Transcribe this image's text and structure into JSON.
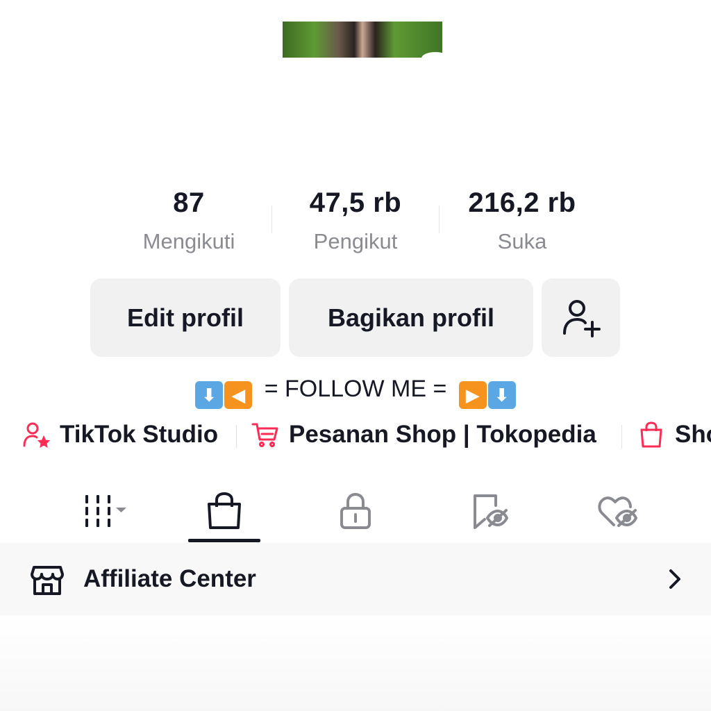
{
  "stats": {
    "following": {
      "value": "87",
      "label": "Mengikuti"
    },
    "followers": {
      "value": "47,5 rb",
      "label": "Pengikut"
    },
    "likes": {
      "value": "216,2 rb",
      "label": "Suka"
    }
  },
  "buttons": {
    "edit": "Edit profil",
    "share": "Bagikan profil",
    "add_friend_icon": "person-add-icon"
  },
  "bio": {
    "left_emojis": [
      "⬇",
      "◀"
    ],
    "text": "= FOLLOW ME =",
    "right_emojis": [
      "▶",
      "⬇"
    ]
  },
  "links": [
    {
      "label": "TikTok Studio",
      "icon": "person-star-icon"
    },
    {
      "label": "Pesanan Shop | Tokopedia",
      "icon": "cart-icon"
    },
    {
      "label": "Sho",
      "icon": "shopping-bag-icon"
    }
  ],
  "tabs": [
    {
      "name": "videos-grid",
      "icon": "grid-bars-icon",
      "active": false
    },
    {
      "name": "shop",
      "icon": "shopping-bag-icon",
      "active": true
    },
    {
      "name": "private",
      "icon": "lock-icon",
      "active": false
    },
    {
      "name": "reposts",
      "icon": "bookmark-hidden-icon",
      "active": false
    },
    {
      "name": "liked",
      "icon": "heart-hidden-icon",
      "active": false
    }
  ],
  "affiliate": {
    "label": "Affiliate Center",
    "icon": "storefront-icon"
  },
  "colors": {
    "accent": "#fe2c55",
    "text": "#161823",
    "muted": "#8a8b91",
    "button_bg": "#f1f1f2"
  }
}
